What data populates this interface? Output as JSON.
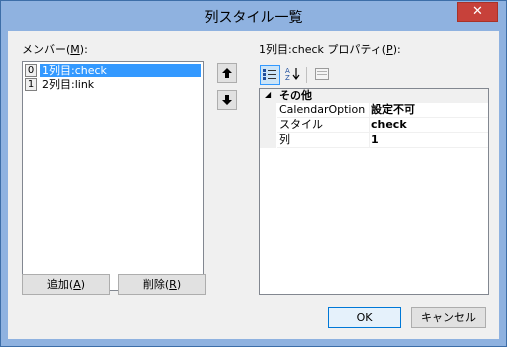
{
  "window": {
    "title": "列スタイル一覧",
    "close_glyph": "✕"
  },
  "members": {
    "label_pre": "メンバー(",
    "label_key": "M",
    "label_post": "):",
    "items": [
      {
        "index": "0",
        "name": "1列目:check",
        "selected": true
      },
      {
        "index": "1",
        "name": "2列目:link",
        "selected": false
      }
    ],
    "move_up_glyph": "🡅",
    "move_down_glyph": "🡇",
    "add_pre": "追加(",
    "add_key": "A",
    "add_post": ")",
    "remove_pre": "削除(",
    "remove_key": "R",
    "remove_post": ")"
  },
  "properties": {
    "label_pre": "1列目:check プロパティ(",
    "label_key": "P",
    "label_post": "):",
    "toolbar": [
      {
        "icon": "categorized-icon",
        "active": true
      },
      {
        "icon": "alphabetical-icon",
        "active": false
      },
      {
        "icon": "property-pages-icon",
        "active": false
      }
    ],
    "category": {
      "expander": "◢",
      "name": "その他"
    },
    "rows": [
      {
        "name": "CalendarOption",
        "value": "設定不可"
      },
      {
        "name": "スタイル",
        "value": "check"
      },
      {
        "name": "列",
        "value": "1"
      }
    ]
  },
  "footer": {
    "ok_label": "OK",
    "cancel_label": "キャンセル"
  }
}
